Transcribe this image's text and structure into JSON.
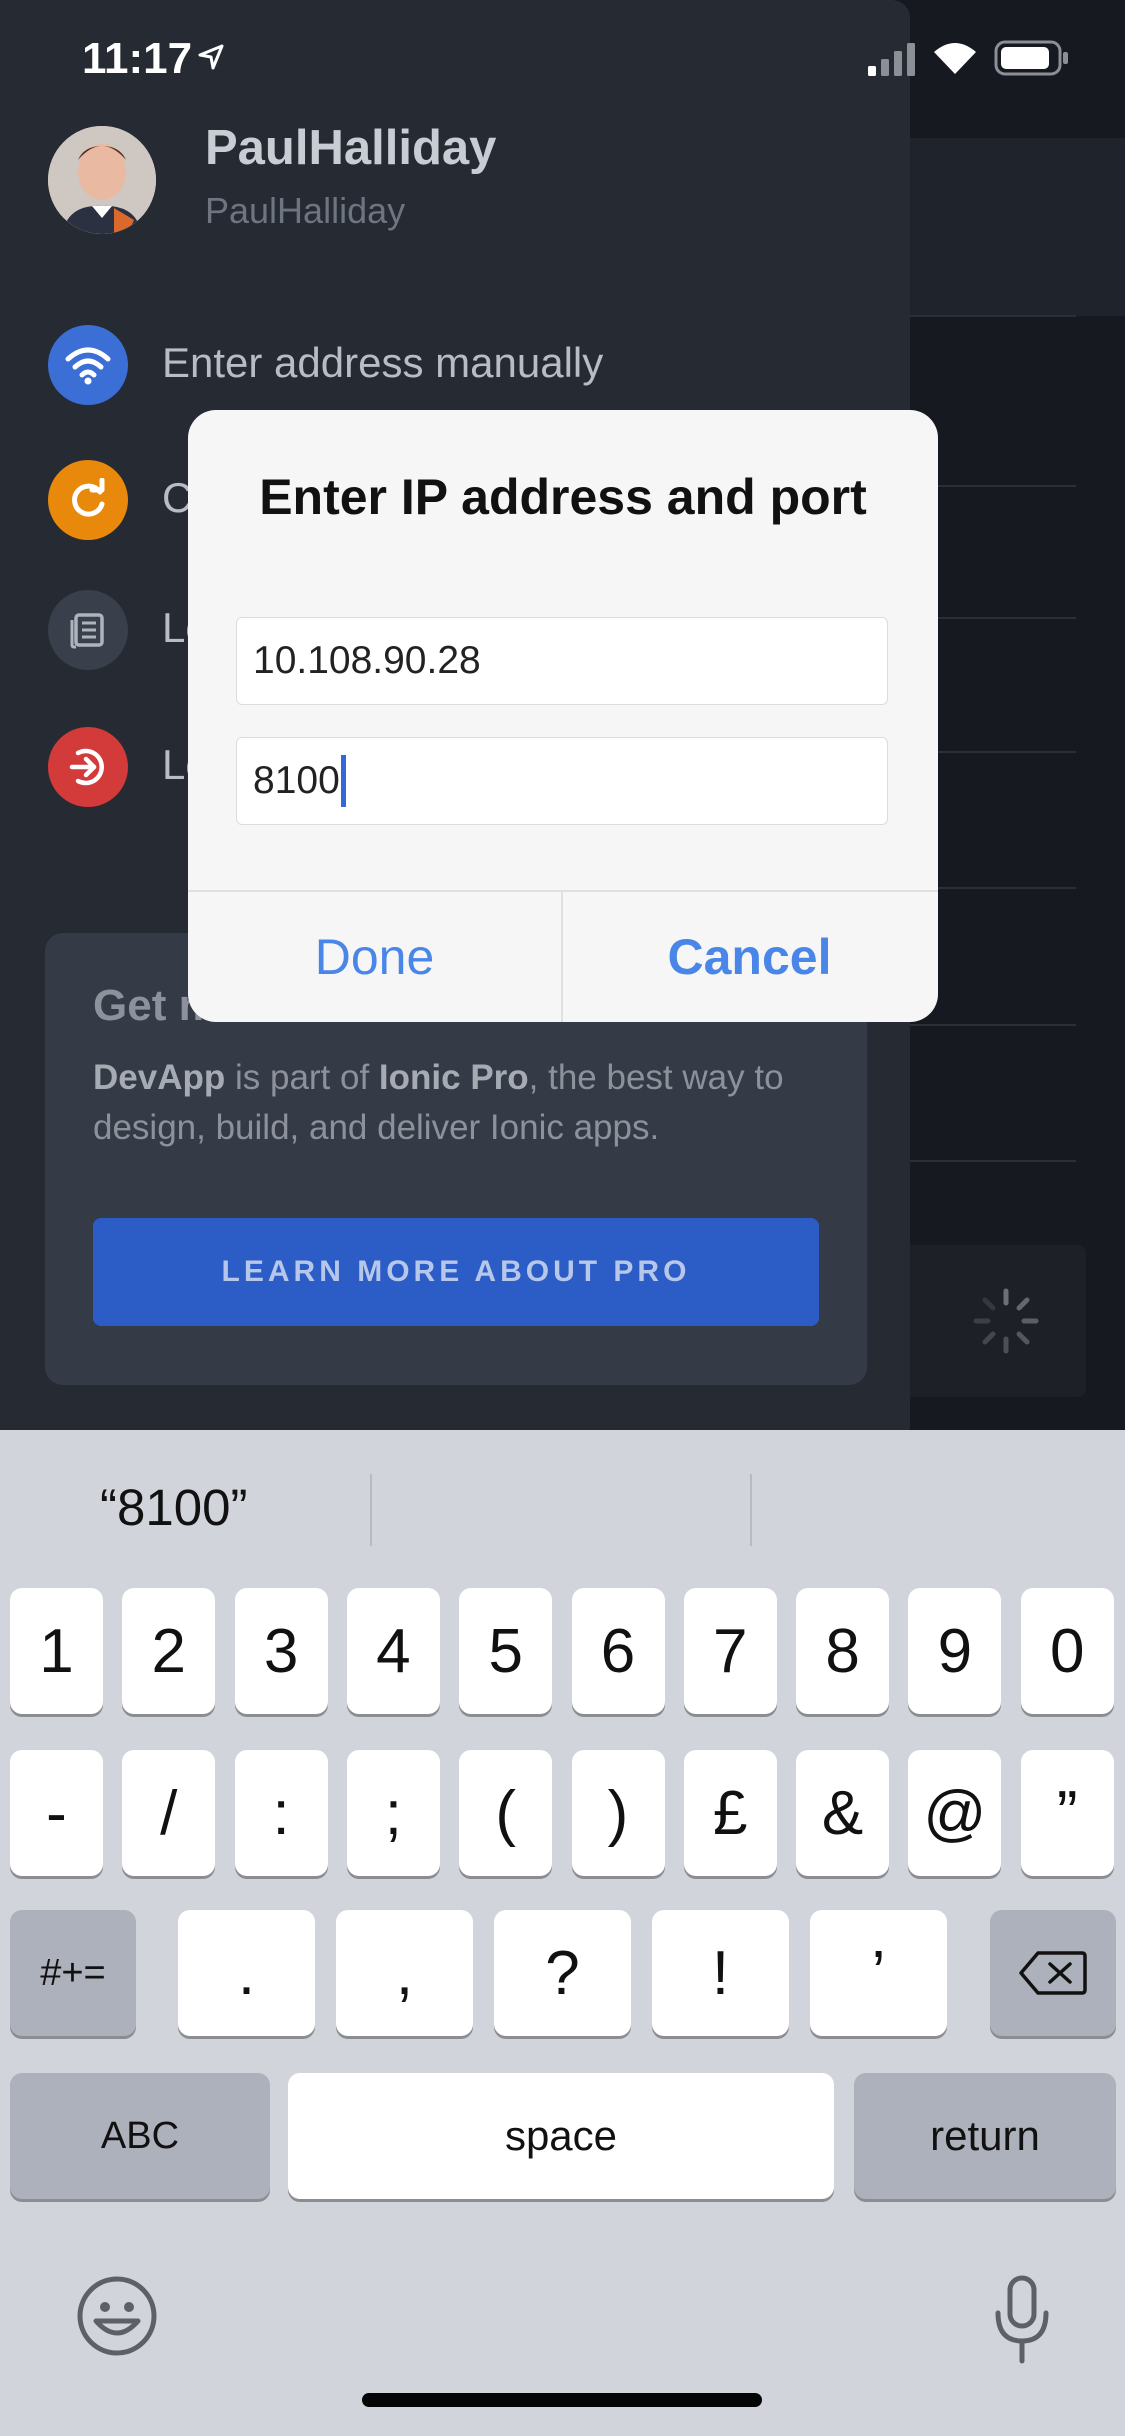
{
  "status_bar": {
    "time": "11:17"
  },
  "drawer": {
    "user": {
      "name": "PaulHalliday",
      "handle": "PaulHalliday"
    },
    "menu_items": [
      {
        "label": "Enter address manually",
        "icon": "wifi-icon",
        "color": "#3b6fd6"
      },
      {
        "label": "C",
        "icon": "refresh-icon",
        "color": "#e8890c"
      },
      {
        "label": "Lo",
        "icon": "document-icon",
        "color": "#3a404b"
      },
      {
        "label": "Lo",
        "icon": "logout-icon",
        "color": "#d33a3a"
      }
    ],
    "promo": {
      "title": "Get more out of Ionic",
      "body_prefix_bold": "DevApp",
      "body_mid": " is part of ",
      "body_mid_bold": "Ionic Pro",
      "body_suffix": ", the best way to design, build, and deliver Ionic apps.",
      "button_label": "LEARN MORE ABOUT PRO"
    }
  },
  "dialog": {
    "title": "Enter IP address and port",
    "ip_value": "10.108.90.28",
    "port_value": "8100",
    "done_label": "Done",
    "cancel_label": "Cancel"
  },
  "keyboard": {
    "suggestion": "“8100”",
    "row1": [
      "1",
      "2",
      "3",
      "4",
      "5",
      "6",
      "7",
      "8",
      "9",
      "0"
    ],
    "row2": [
      "-",
      "/",
      ":",
      ";",
      "(",
      ")",
      "£",
      "&",
      "@",
      "”"
    ],
    "row3_left": "#+=",
    "row3": [
      ".",
      ",",
      "?",
      "!",
      "’"
    ],
    "abc_label": "ABC",
    "space_label": "space",
    "return_label": "return"
  }
}
